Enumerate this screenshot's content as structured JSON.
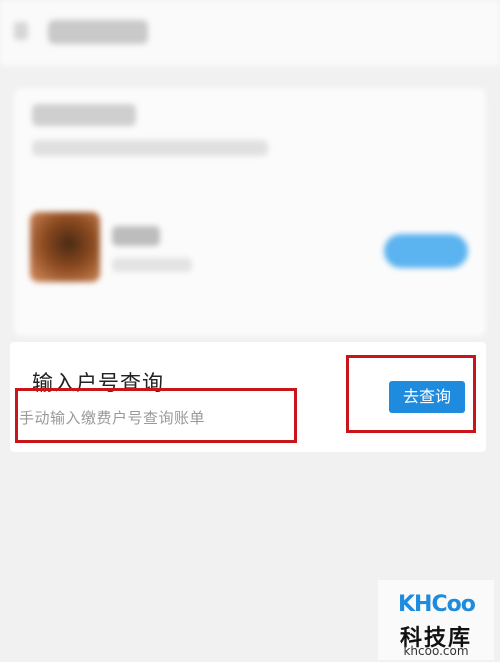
{
  "query_card": {
    "title": "输入户号查询",
    "subtitle": "手动输入缴费户号查询账单",
    "button_label": "去查询"
  },
  "watermark": {
    "logo_text": "KHCoo",
    "title": "科技库",
    "domain": "khcoo.com"
  },
  "colors": {
    "accent_blue": "#1f8bde",
    "highlight_red": "#c7151b"
  }
}
